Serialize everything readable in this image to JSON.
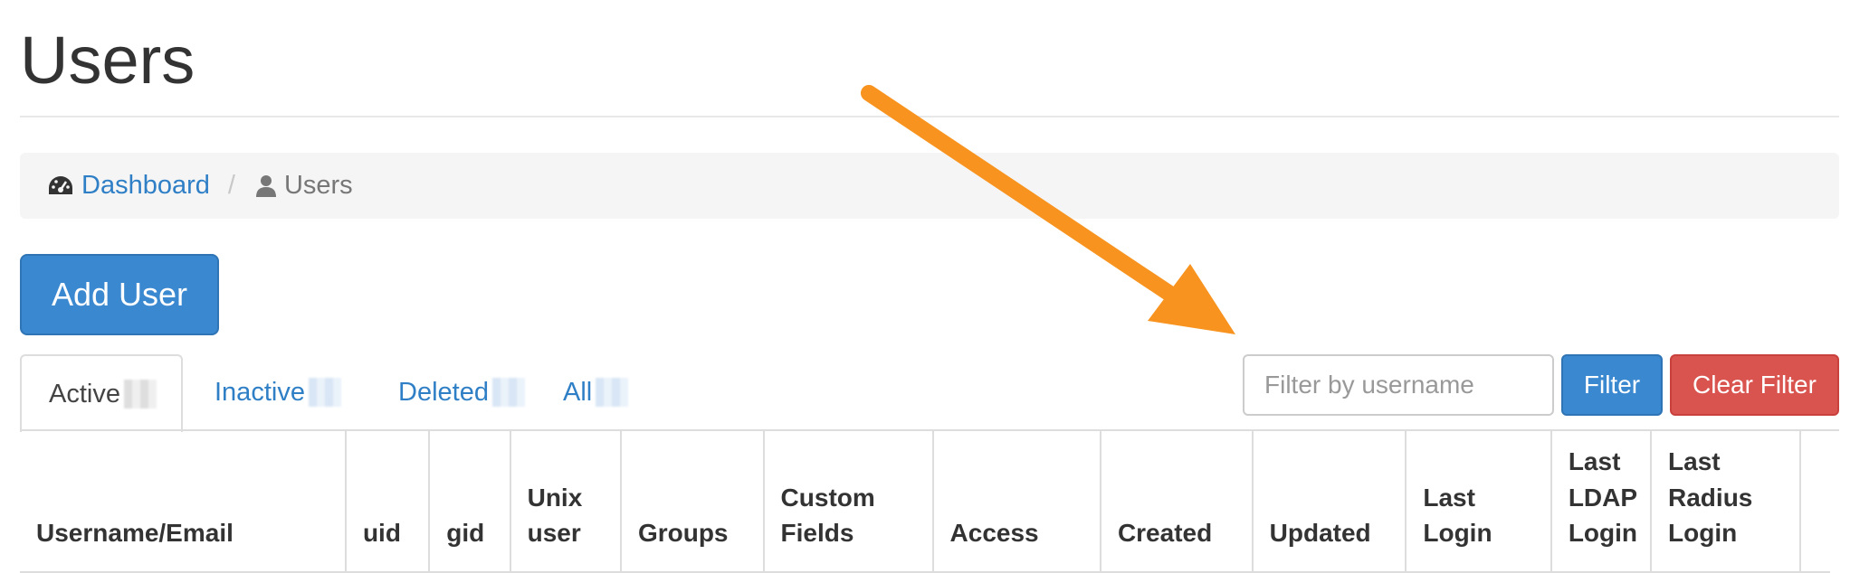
{
  "page": {
    "title": "Users"
  },
  "breadcrumb": {
    "dashboard_label": "Dashboard",
    "separator": "/",
    "current_label": "Users"
  },
  "actions": {
    "add_user_label": "Add User"
  },
  "tabs": [
    {
      "label": "Active",
      "active": true
    },
    {
      "label": "Inactive",
      "active": false
    },
    {
      "label": "Deleted",
      "active": false
    },
    {
      "label": "All",
      "active": false
    }
  ],
  "filter": {
    "placeholder": "Filter by username",
    "value": "",
    "filter_label": "Filter",
    "clear_label": "Clear Filter"
  },
  "table": {
    "columns": [
      "Username/Email",
      "uid",
      "gid",
      "Unix user",
      "Groups",
      "Custom Fields",
      "Access",
      "Created",
      "Updated",
      "Last Login",
      "Last LDAP Login",
      "Last Radius Login",
      ""
    ]
  },
  "colors": {
    "link": "#2f7fc6",
    "primary": "#3a88d0",
    "danger": "#d9534f",
    "annotation_arrow": "#f7931e"
  },
  "icons": {
    "dashboard": "dashboard-icon",
    "users": "user-icon"
  }
}
